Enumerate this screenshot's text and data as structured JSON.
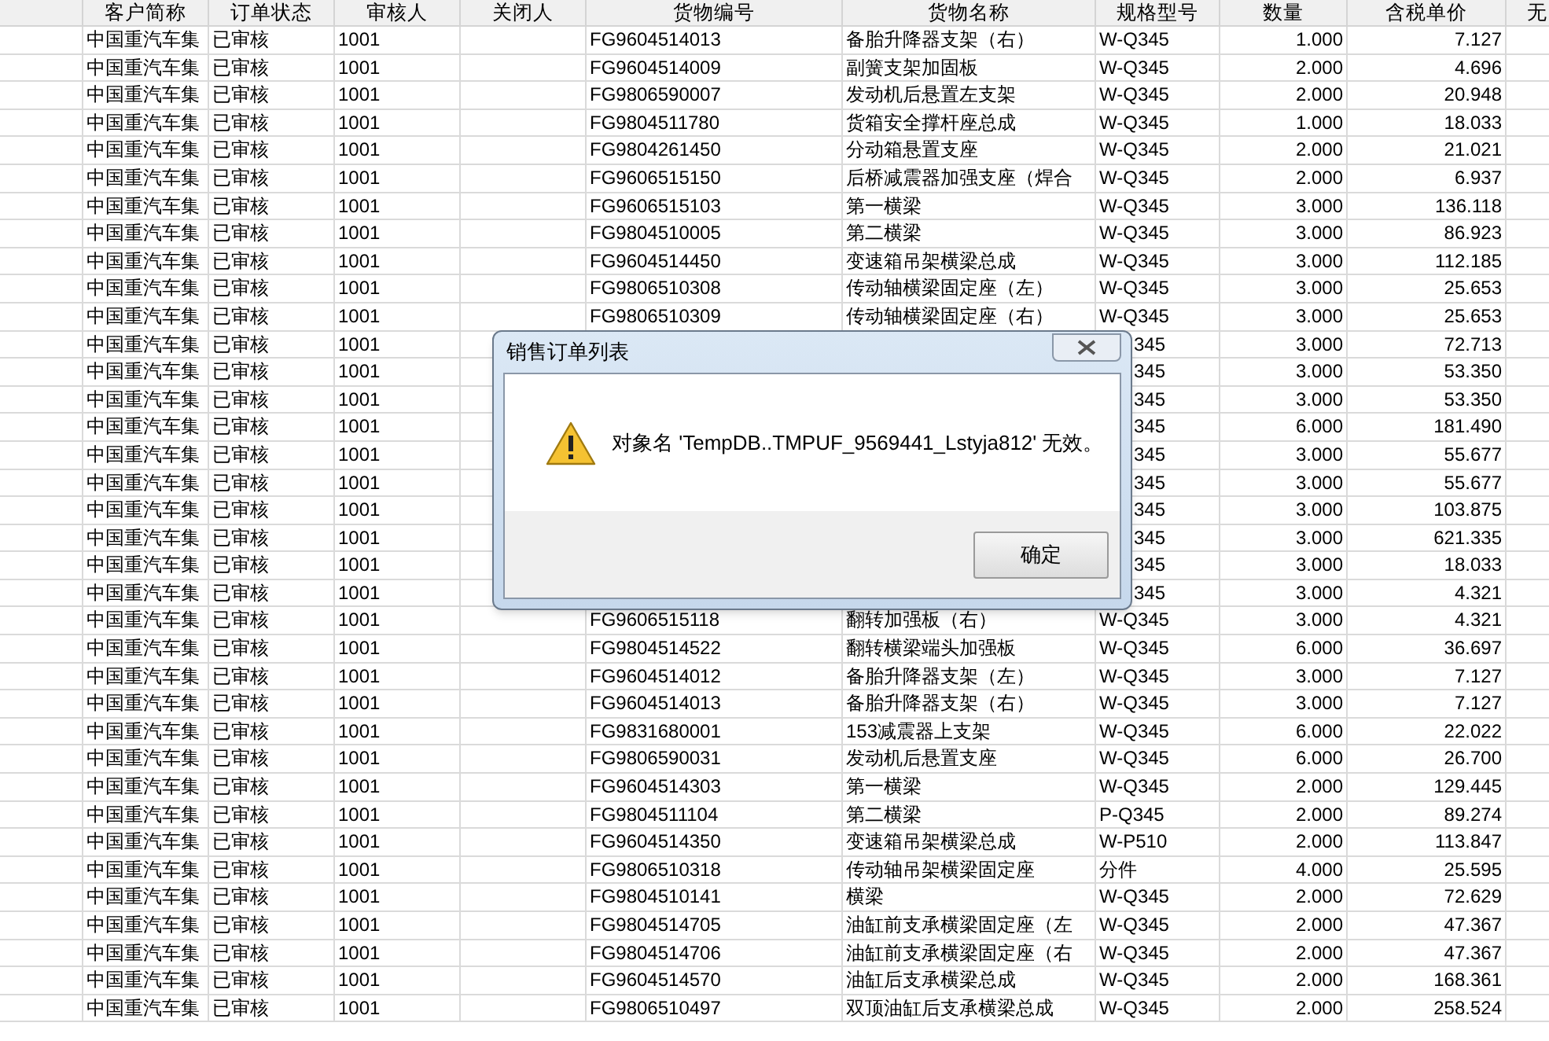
{
  "table": {
    "columns": [
      "客户简称",
      "订单状态",
      "审核人",
      "关闭人",
      "货物编号",
      "货物名称",
      "规格型号",
      "数量",
      "含税单价",
      "无"
    ],
    "rows": [
      {
        "covered": false,
        "cells": [
          "中国重汽车集",
          "已审核",
          "1001",
          "",
          "FG9604514013",
          "备胎升降器支架（右）",
          "W-Q345",
          "1.000",
          "7.127"
        ]
      },
      {
        "covered": false,
        "cells": [
          "中国重汽车集",
          "已审核",
          "1001",
          "",
          "FG9604514009",
          "副簧支架加固板",
          "W-Q345",
          "2.000",
          "4.696"
        ]
      },
      {
        "covered": false,
        "cells": [
          "中国重汽车集",
          "已审核",
          "1001",
          "",
          "FG9806590007",
          "发动机后悬置左支架",
          "W-Q345",
          "2.000",
          "20.948"
        ]
      },
      {
        "covered": false,
        "cells": [
          "中国重汽车集",
          "已审核",
          "1001",
          "",
          "FG9804511780",
          "货箱安全撑杆座总成",
          "W-Q345",
          "1.000",
          "18.033"
        ]
      },
      {
        "covered": false,
        "cells": [
          "中国重汽车集",
          "已审核",
          "1001",
          "",
          "FG9804261450",
          "分动箱悬置支座",
          "W-Q345",
          "2.000",
          "21.021"
        ]
      },
      {
        "covered": false,
        "cells": [
          "中国重汽车集",
          "已审核",
          "1001",
          "",
          "FG9606515150",
          "后桥减震器加强支座（焊合",
          "W-Q345",
          "2.000",
          "6.937"
        ]
      },
      {
        "covered": false,
        "cells": [
          "中国重汽车集",
          "已审核",
          "1001",
          "",
          "FG9606515103",
          "第一横梁",
          "W-Q345",
          "3.000",
          "136.118"
        ]
      },
      {
        "covered": false,
        "cells": [
          "中国重汽车集",
          "已审核",
          "1001",
          "",
          "FG9804510005",
          "第二横梁",
          "W-Q345",
          "3.000",
          "86.923"
        ]
      },
      {
        "covered": false,
        "cells": [
          "中国重汽车集",
          "已审核",
          "1001",
          "",
          "FG9604514450",
          "变速箱吊架横梁总成",
          "W-Q345",
          "3.000",
          "112.185"
        ]
      },
      {
        "covered": false,
        "cells": [
          "中国重汽车集",
          "已审核",
          "1001",
          "",
          "FG9806510308",
          "传动轴横梁固定座（左）",
          "W-Q345",
          "3.000",
          "25.653"
        ]
      },
      {
        "covered": false,
        "cells": [
          "中国重汽车集",
          "已审核",
          "1001",
          "",
          "FG9806510309",
          "传动轴横梁固定座（右）",
          "W-Q345",
          "3.000",
          "25.653"
        ]
      },
      {
        "covered": true,
        "cells": [
          "中国重汽车集",
          "已审核",
          "1001",
          "",
          "",
          "",
          "345",
          "3.000",
          "72.713"
        ]
      },
      {
        "covered": true,
        "cells": [
          "中国重汽车集",
          "已审核",
          "1001",
          "",
          "",
          "",
          "345",
          "3.000",
          "53.350"
        ]
      },
      {
        "covered": true,
        "cells": [
          "中国重汽车集",
          "已审核",
          "1001",
          "",
          "",
          "",
          "345",
          "3.000",
          "53.350"
        ]
      },
      {
        "covered": true,
        "cells": [
          "中国重汽车集",
          "已审核",
          "1001",
          "",
          "",
          "",
          "345",
          "6.000",
          "181.490"
        ]
      },
      {
        "covered": true,
        "cells": [
          "中国重汽车集",
          "已审核",
          "1001",
          "",
          "",
          "",
          "345",
          "3.000",
          "55.677"
        ]
      },
      {
        "covered": true,
        "cells": [
          "中国重汽车集",
          "已审核",
          "1001",
          "",
          "",
          "",
          "345",
          "3.000",
          "55.677"
        ]
      },
      {
        "covered": true,
        "cells": [
          "中国重汽车集",
          "已审核",
          "1001",
          "",
          "",
          "",
          "345",
          "3.000",
          "103.875"
        ]
      },
      {
        "covered": true,
        "cells": [
          "中国重汽车集",
          "已审核",
          "1001",
          "",
          "",
          "",
          "345",
          "3.000",
          "621.335"
        ]
      },
      {
        "covered": true,
        "cells": [
          "中国重汽车集",
          "已审核",
          "1001",
          "",
          "",
          "",
          "345",
          "3.000",
          "18.033"
        ]
      },
      {
        "covered": true,
        "cells": [
          "中国重汽车集",
          "已审核",
          "1001",
          "",
          "",
          "",
          "345",
          "3.000",
          "4.321"
        ]
      },
      {
        "covered": false,
        "cells": [
          "中国重汽车集",
          "已审核",
          "1001",
          "",
          "FG9606515118",
          "翻转加强板（右）",
          "W-Q345",
          "3.000",
          "4.321"
        ]
      },
      {
        "covered": false,
        "cells": [
          "中国重汽车集",
          "已审核",
          "1001",
          "",
          "FG9804514522",
          "翻转横梁端头加强板",
          "W-Q345",
          "6.000",
          "36.697"
        ]
      },
      {
        "covered": false,
        "cells": [
          "中国重汽车集",
          "已审核",
          "1001",
          "",
          "FG9604514012",
          "备胎升降器支架（左）",
          "W-Q345",
          "3.000",
          "7.127"
        ]
      },
      {
        "covered": false,
        "cells": [
          "中国重汽车集",
          "已审核",
          "1001",
          "",
          "FG9604514013",
          "备胎升降器支架（右）",
          "W-Q345",
          "3.000",
          "7.127"
        ]
      },
      {
        "covered": false,
        "cells": [
          "中国重汽车集",
          "已审核",
          "1001",
          "",
          "FG9831680001",
          "153减震器上支架",
          "W-Q345",
          "6.000",
          "22.022"
        ]
      },
      {
        "covered": false,
        "cells": [
          "中国重汽车集",
          "已审核",
          "1001",
          "",
          "FG9806590031",
          "发动机后悬置支座",
          "W-Q345",
          "6.000",
          "26.700"
        ]
      },
      {
        "covered": false,
        "cells": [
          "中国重汽车集",
          "已审核",
          "1001",
          "",
          "FG9604514303",
          "第一横梁",
          "W-Q345",
          "2.000",
          "129.445"
        ]
      },
      {
        "covered": false,
        "cells": [
          "中国重汽车集",
          "已审核",
          "1001",
          "",
          "FG9804511104",
          "第二横梁",
          "P-Q345",
          "2.000",
          "89.274"
        ]
      },
      {
        "covered": false,
        "cells": [
          "中国重汽车集",
          "已审核",
          "1001",
          "",
          "FG9604514350",
          "变速箱吊架横梁总成",
          "W-P510",
          "2.000",
          "113.847"
        ]
      },
      {
        "covered": false,
        "cells": [
          "中国重汽车集",
          "已审核",
          "1001",
          "",
          "FG9806510318",
          "传动轴吊架横梁固定座",
          "分件",
          "4.000",
          "25.595"
        ]
      },
      {
        "covered": false,
        "cells": [
          "中国重汽车集",
          "已审核",
          "1001",
          "",
          "FG9804510141",
          "横梁",
          "W-Q345",
          "2.000",
          "72.629"
        ]
      },
      {
        "covered": false,
        "cells": [
          "中国重汽车集",
          "已审核",
          "1001",
          "",
          "FG9804514705",
          "油缸前支承横梁固定座（左",
          "W-Q345",
          "2.000",
          "47.367"
        ]
      },
      {
        "covered": false,
        "cells": [
          "中国重汽车集",
          "已审核",
          "1001",
          "",
          "FG9804514706",
          "油缸前支承横梁固定座（右",
          "W-Q345",
          "2.000",
          "47.367"
        ]
      },
      {
        "covered": false,
        "cells": [
          "中国重汽车集",
          "已审核",
          "1001",
          "",
          "FG9604514570",
          "油缸后支承横梁总成",
          "W-Q345",
          "2.000",
          "168.361"
        ]
      },
      {
        "covered": false,
        "cells": [
          "中国重汽车集",
          "已审核",
          "1001",
          "",
          "FG9806510497",
          "双顶油缸后支承横梁总成",
          "W-Q345",
          "2.000",
          "258.524"
        ]
      }
    ]
  },
  "dialog": {
    "title": "销售订单列表",
    "message": "对象名 'TempDB..TMPUF_9569441_Lstyja812' 无效。",
    "button": "确定"
  }
}
